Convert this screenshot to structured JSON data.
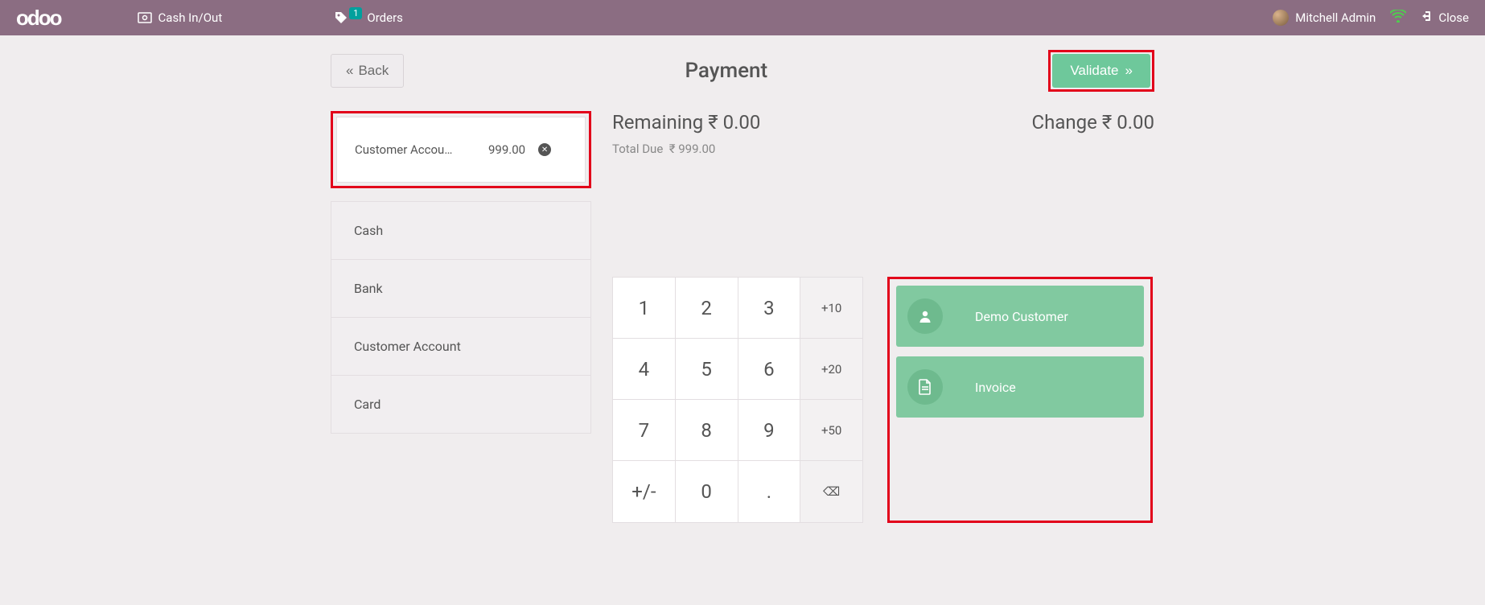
{
  "navbar": {
    "brand": "odoo",
    "cash": "Cash In/Out",
    "orders": "Orders",
    "orders_badge": "1",
    "user": "Mitchell Admin",
    "close": "Close"
  },
  "header": {
    "back": "Back",
    "title": "Payment",
    "validate": "Validate"
  },
  "payment_line": {
    "method": "Customer Accou…",
    "amount": "999.00"
  },
  "methods": [
    "Cash",
    "Bank",
    "Customer Account",
    "Card"
  ],
  "totals": {
    "remaining_label": "Remaining",
    "remaining_value": "₹ 0.00",
    "total_due_label": "Total Due",
    "total_due_value": "₹ 999.00",
    "change_label": "Change",
    "change_value": "₹ 0.00"
  },
  "numpad": {
    "keys": [
      [
        "1",
        "2",
        "3",
        "+10"
      ],
      [
        "4",
        "5",
        "6",
        "+20"
      ],
      [
        "7",
        "8",
        "9",
        "+50"
      ],
      [
        "+/-",
        "0",
        ".",
        "⌫"
      ]
    ]
  },
  "actions": {
    "customer": "Demo Customer",
    "invoice": "Invoice"
  }
}
